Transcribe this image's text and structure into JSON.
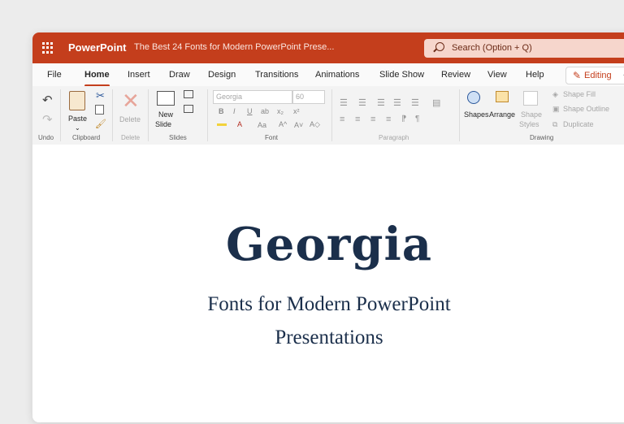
{
  "app": {
    "name": "PowerPoint",
    "doc_title": "The Best 24 Fonts for Modern PowerPoint Prese...",
    "search_placeholder": "Search (Option + Q)",
    "accent": "#c43e1c"
  },
  "tabs": [
    "File",
    "Home",
    "Insert",
    "Draw",
    "Design",
    "Transitions",
    "Animations",
    "Slide Show",
    "Review",
    "View",
    "Help"
  ],
  "active_tab": "Home",
  "editing_label": "Editing",
  "ribbon": {
    "groups": {
      "undo": "Undo",
      "clipboard": "Clipboard",
      "delete": "Delete",
      "slides": "Slides",
      "font": "Font",
      "paragraph": "Paragraph",
      "drawing": "Drawing"
    },
    "paste": "Paste",
    "delete_btn": "Delete",
    "new_slide_1": "New",
    "new_slide_2": "Slide",
    "font_name": "Georgia",
    "font_size": "60",
    "shapes": "Shapes",
    "arrange": "Arrange",
    "shape_styles_1": "Shape",
    "shape_styles_2": "Styles",
    "shape_fill": "Shape Fill",
    "shape_outline": "Shape Outline",
    "duplicate": "Duplicate"
  },
  "slide": {
    "title": "Georgia",
    "subtitle_line1": "Fonts for Modern PowerPoint",
    "subtitle_line2": "Presentations"
  }
}
